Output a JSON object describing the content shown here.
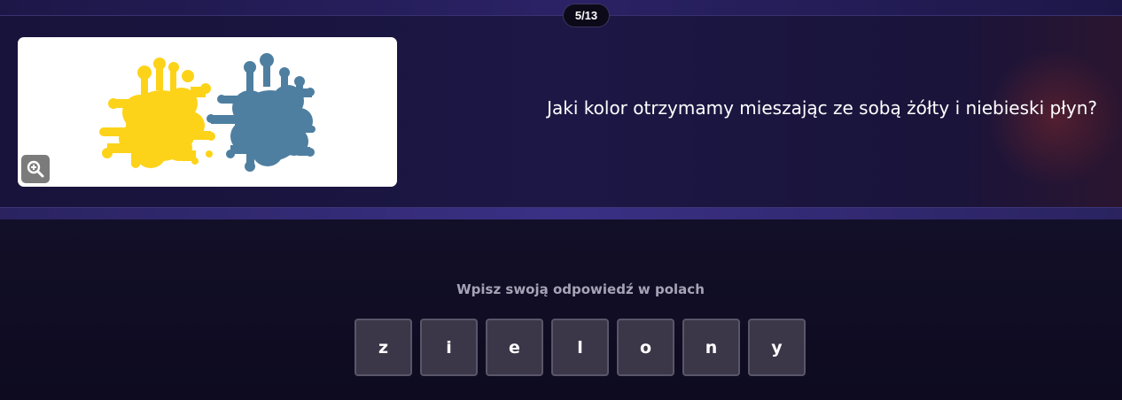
{
  "progress": {
    "counter": "5/13"
  },
  "question": {
    "text": "Jaki kolor otrzymamy mieszając ze sobą żółty i niebieski płyn?",
    "image": {
      "description_icons": [
        "yellow-paint-splat",
        "blue-paint-splat"
      ],
      "colors": {
        "yellow": "#fdd319",
        "blue": "#4e7fa0"
      }
    },
    "zoom_icon": "zoom-in-icon"
  },
  "answer": {
    "instruction": "Wpisz swoją odpowiedź w polach",
    "letters": [
      "z",
      "i",
      "e",
      "l",
      "o",
      "n",
      "y"
    ]
  },
  "colors": {
    "background": "#0f0b1f",
    "tile": "#3b3748",
    "tile_border": "#5a566a",
    "instruction_text": "#a7a3b6"
  }
}
